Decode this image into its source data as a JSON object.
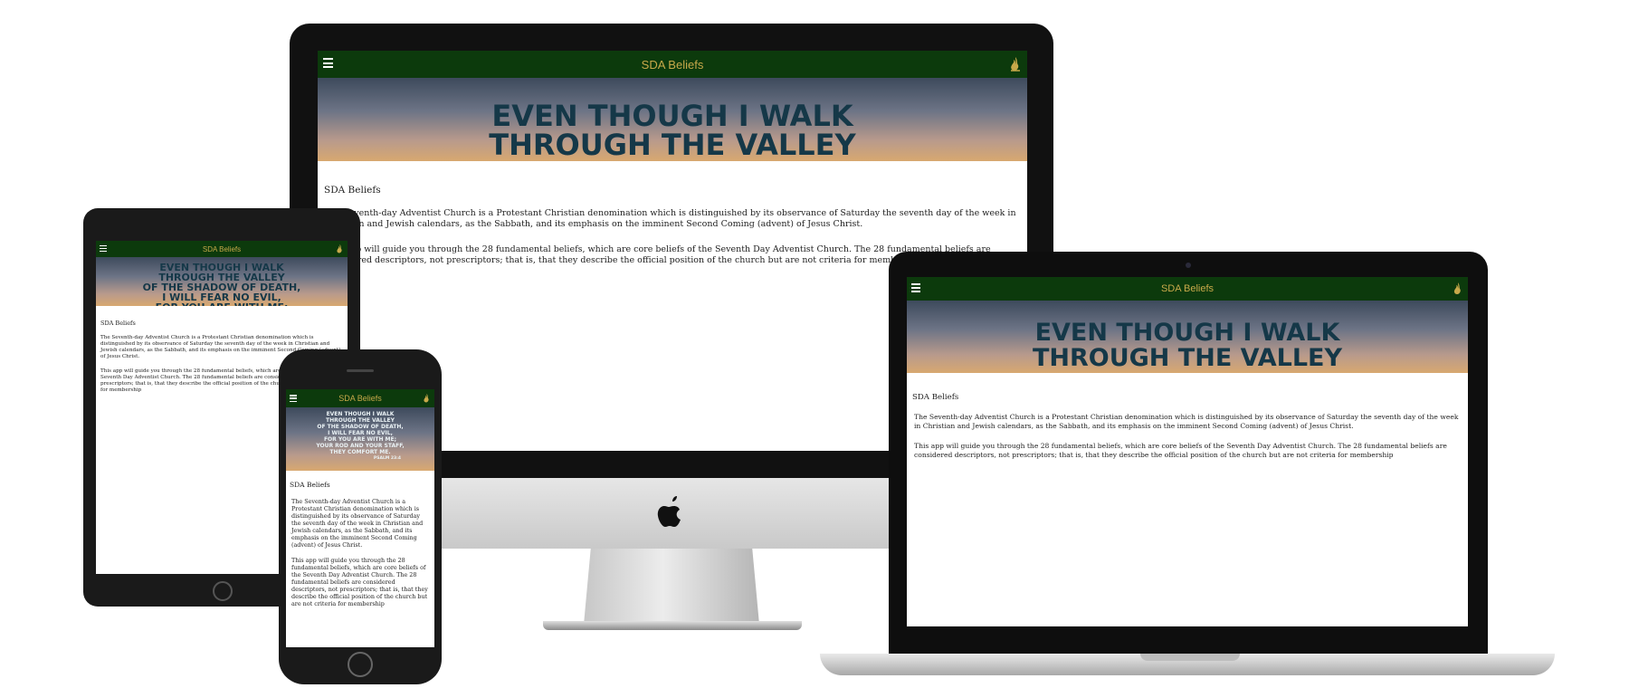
{
  "app": {
    "title": "SDA Beliefs",
    "menu_icon": "hamburger-menu-icon",
    "logo_icon": "adventist-flame-logo-icon",
    "header_bg": "#0c3a0c",
    "title_color": "#c8a94a"
  },
  "hero": {
    "lines_long": [
      "EVEN THOUGH I WALK",
      "THROUGH THE VALLEY",
      "OF THE SHADOW OF DEATH,",
      "I WILL FEAR NO EVIL,",
      "FOR YOU ARE WITH ME;",
      "YOUR ROD AND YOUR STAFF,",
      "THEY COMFORT ME."
    ],
    "reference": "PSALM 23:4"
  },
  "content": {
    "heading": "SDA Beliefs",
    "paragraph_1": "The Seventh-day Adventist Church is a Protestant Christian denomination which is distinguished by its observance of Saturday the seventh day of the week in Christian and Jewish calendars, as the Sabbath, and its emphasis on the imminent Second Coming (advent) of Jesus Christ.",
    "paragraph_2": "This app will guide you through the 28 fundamental beliefs, which are core beliefs of the Seventh Day Adventist Church. The 28 fundamental beliefs are considered descriptors, not prescriptors; that is, that they describe the official position of the church but are not criteria for membership"
  }
}
